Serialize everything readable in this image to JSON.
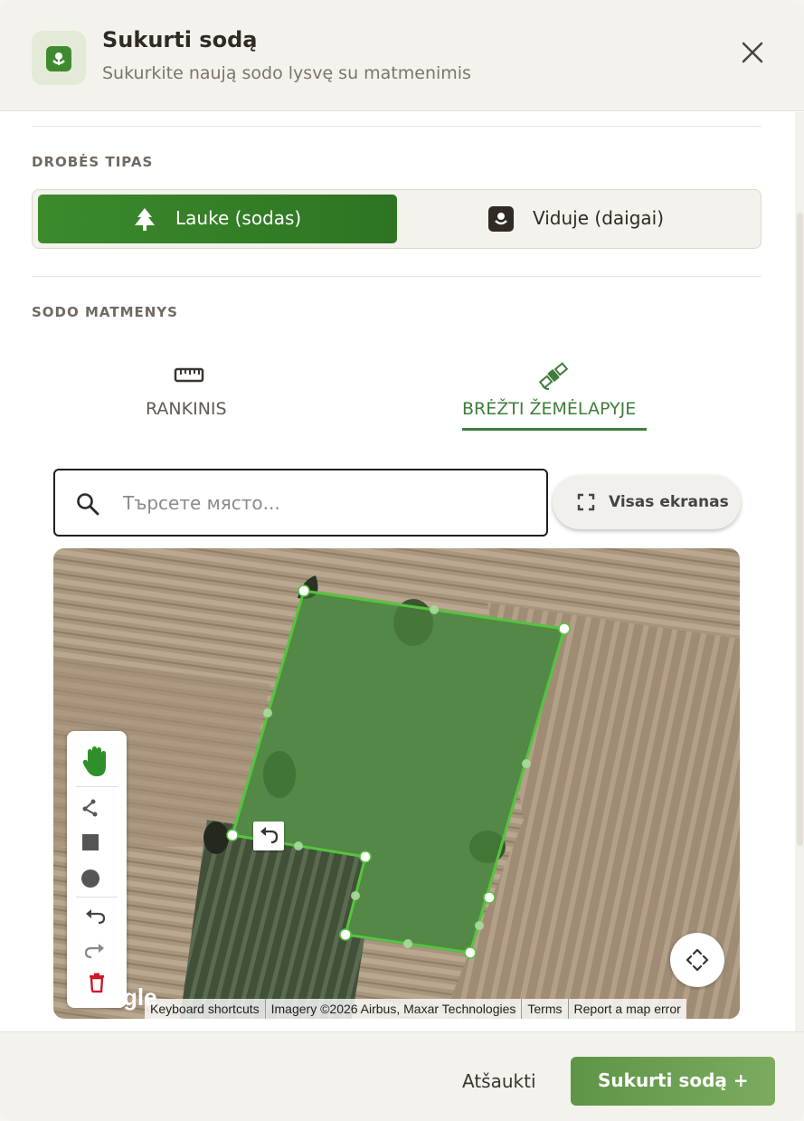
{
  "header": {
    "title": "Sukurti sodą",
    "subtitle": "Sukurkite naują sodo lysvę su matmenimis",
    "icon": "sprout-icon",
    "close_icon": "close-icon"
  },
  "canvas_type": {
    "section_label": "DROBĖS TIPAS",
    "options": [
      {
        "label": "Lauke (sodas)",
        "icon": "tree-icon",
        "selected": true
      },
      {
        "label": "Viduje (daigai)",
        "icon": "sprout-icon",
        "selected": false
      }
    ]
  },
  "dimensions": {
    "section_label": "SODO MATMENYS",
    "tabs": [
      {
        "label": "RANKINIS",
        "icon": "ruler-icon",
        "active": false
      },
      {
        "label": "BRĖŽTI ŽEMĖLAPYJE",
        "icon": "satellite-icon",
        "active": true
      }
    ]
  },
  "map": {
    "search_placeholder": "Търсете място...",
    "fullscreen_label": "Visas ekranas",
    "logo_text": "Google",
    "attribution": [
      "Keyboard shortcuts",
      "Imagery ©2026 Airbus, Maxar Technologies",
      "Terms",
      "Report a map error"
    ],
    "tools": [
      "hand-icon",
      "polyline-icon",
      "rectangle-icon",
      "circle-icon",
      "undo-icon",
      "redo-icon",
      "delete-icon"
    ]
  },
  "footer": {
    "cancel_label": "Atšaukti",
    "create_label": "Sukurti sodą +"
  },
  "colors": {
    "accent": "#3c8a2c",
    "polygon": "#4cc23a",
    "delete": "#d0182a"
  }
}
